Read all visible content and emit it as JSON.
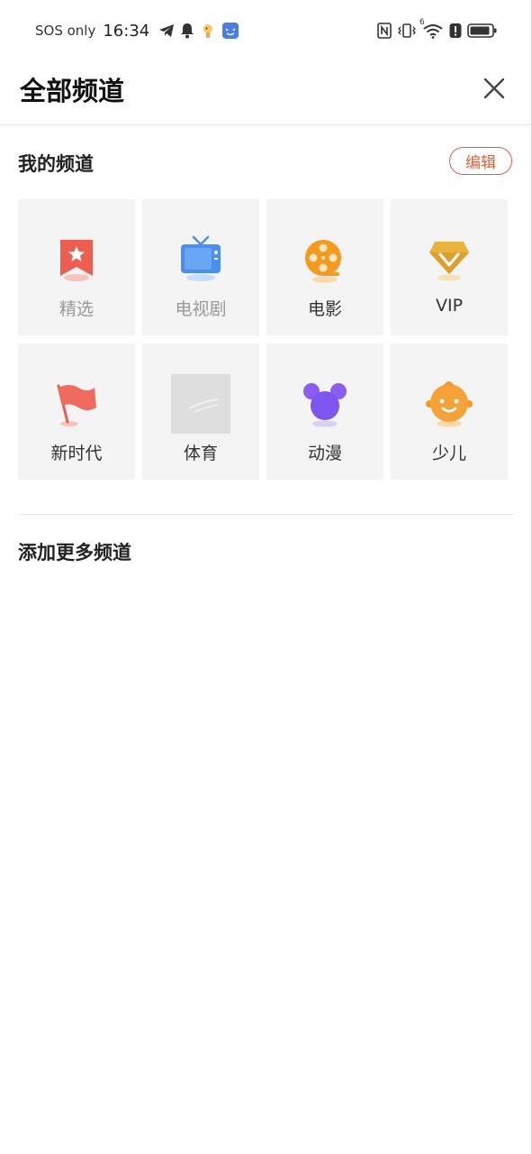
{
  "status_bar": {
    "carrier": "SOS only",
    "time": "16:34",
    "left_icons": [
      "telegram-icon",
      "bell-icon",
      "cartoon-app-icon",
      "blue-app-icon"
    ],
    "right_icons": [
      "nfc-icon",
      "vibrate-icon",
      "wifi-icon",
      "alert-icon",
      "battery-icon"
    ],
    "wifi_badge": "6"
  },
  "header": {
    "title": "全部频道",
    "close_icon": "close-icon"
  },
  "my_channels": {
    "title": "我的频道",
    "edit_label": "编辑",
    "items": [
      {
        "label": "精选",
        "icon": "bookmark-star-icon",
        "dimmed": true
      },
      {
        "label": "电视剧",
        "icon": "tv-icon",
        "dimmed": true
      },
      {
        "label": "电影",
        "icon": "film-reel-icon",
        "dimmed": false
      },
      {
        "label": "VIP",
        "icon": "diamond-icon",
        "dimmed": false
      },
      {
        "label": "新时代",
        "icon": "flag-icon",
        "dimmed": false
      },
      {
        "label": "体育",
        "icon": "sports-placeholder-icon",
        "dimmed": false
      },
      {
        "label": "动漫",
        "icon": "mouse-head-icon",
        "dimmed": false
      },
      {
        "label": "少儿",
        "icon": "baby-face-icon",
        "dimmed": false
      }
    ]
  },
  "more_channels": {
    "title": "添加更多频道"
  },
  "colors": {
    "edit_border": "#e05a4f",
    "edit_text": "#d9623a",
    "tile_bg": "#f4f4f4"
  }
}
